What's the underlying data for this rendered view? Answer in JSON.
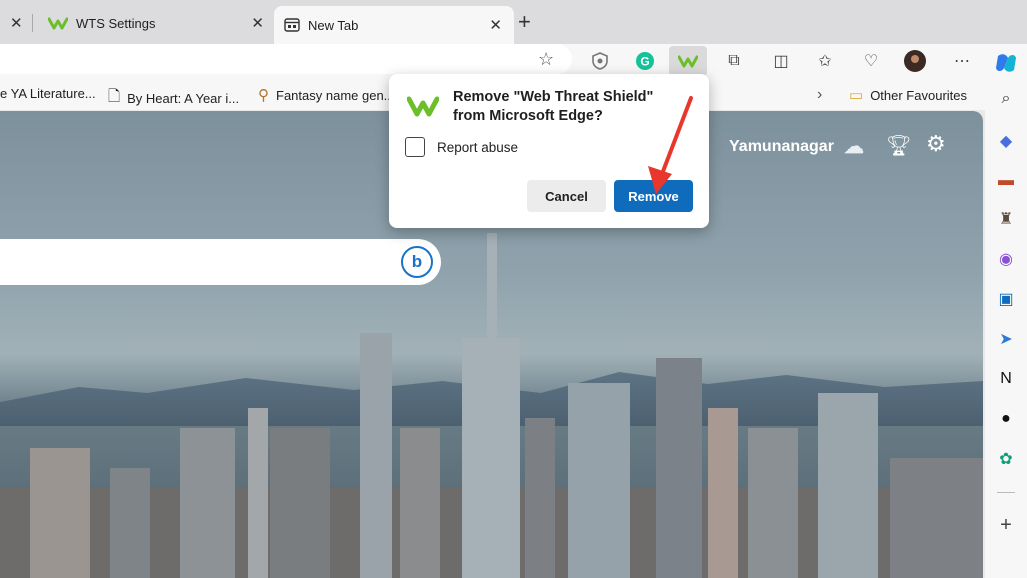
{
  "tabs": [
    {
      "title": "WTS Settings",
      "close": "✕"
    },
    {
      "title": "New Tab",
      "close": "✕"
    }
  ],
  "partial_tab_close": "✕",
  "new_tab_symbol": "+",
  "bookmarks": [
    {
      "label": "e YA Literature..."
    },
    {
      "label": "By Heart: A Year i..."
    },
    {
      "label": "Fantasy name gen..."
    },
    {
      "label": "Other Favourites"
    }
  ],
  "weather": {
    "city": "Yamunanagar"
  },
  "dialog": {
    "title_line1": "Remove \"Web Threat Shield\"",
    "title_line2": "from Microsoft Edge?",
    "checkbox_label": "Report abuse",
    "cancel_label": "Cancel",
    "remove_label": "Remove"
  },
  "colors": {
    "accent": "#0f6cbd",
    "annotation_arrow": "#e8372c",
    "wts_green": "#6cbe2a"
  },
  "icons": {
    "toolbar": [
      "favorite-star-icon",
      "shield-extension-icon",
      "grammarly-icon",
      "wts-extension-icon",
      "extensions-puzzle-icon",
      "split-screen-icon",
      "favorites-icon",
      "browser-essentials-icon",
      "profile-avatar",
      "more-menu-icon",
      "copilot-icon"
    ],
    "rail": [
      "search-icon",
      "tag-icon",
      "toolbox-icon",
      "chess-icon",
      "microsoft365-icon",
      "outlook-icon",
      "telegram-icon",
      "notion-icon",
      "circle-app-icon",
      "chatgpt-icon",
      "add-icon"
    ]
  }
}
